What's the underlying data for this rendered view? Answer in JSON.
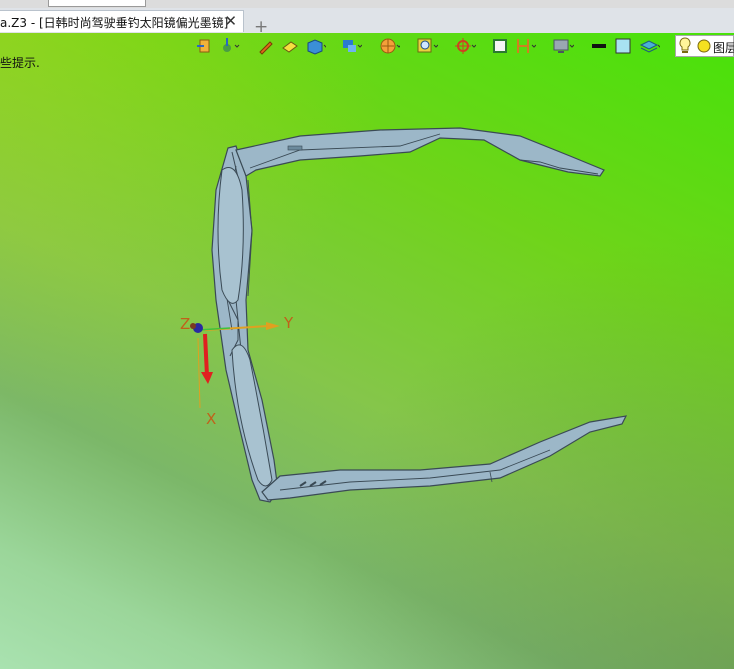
{
  "tab": {
    "title": "a.Z3 - [日韩时尚驾驶垂钓太阳镜偏光墨镜]",
    "close_symbol": "✕",
    "new_tab_symbol": "+"
  },
  "viewport": {
    "hint": "提示.",
    "hint_visible": "些提示."
  },
  "layer": {
    "label": "图层"
  },
  "axes": {
    "x": "X",
    "y": "Y",
    "z": "Z"
  },
  "colors": {
    "viewport_top": "#48e20a",
    "viewport_bottom": "#a9e2b0",
    "model": "#9cb7c8",
    "model_edge": "#3a4a55",
    "axis_x": "#e02020",
    "axis_y": "#e0a020"
  },
  "toolbar_icons": [
    "exit-icon",
    "point-icon",
    "pen-icon",
    "eraser-icon",
    "cube-icon",
    "view-icon",
    "render-icon",
    "zoom-icon",
    "target-icon",
    "frame-icon",
    "measure-icon",
    "monitor-icon",
    "line-color-icon",
    "fill-color-icon",
    "layers-icon",
    "bulb-icon",
    "sun-icon"
  ]
}
